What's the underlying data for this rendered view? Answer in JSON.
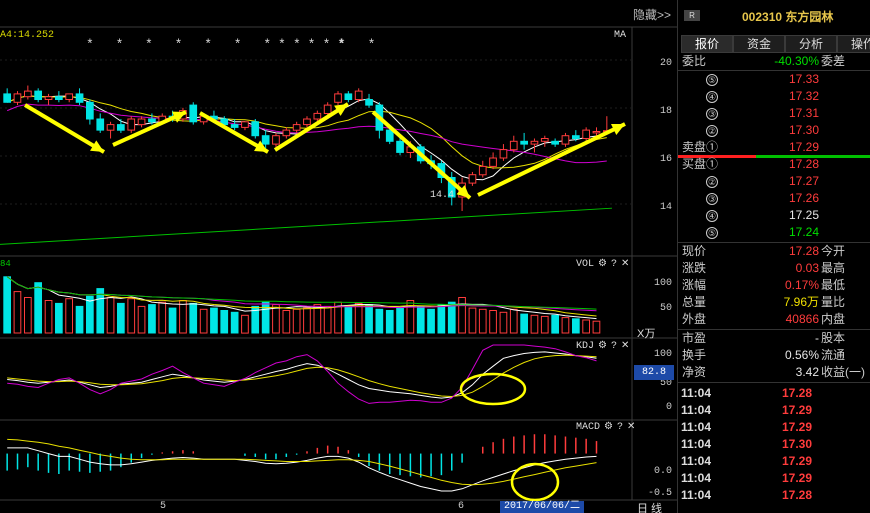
{
  "toolbar": {
    "hide_label": "隐藏>>"
  },
  "main_chart": {
    "ma_readout": "A4:14.252",
    "ma_tag": "MA",
    "stars": [
      "* *",
      "* * * * * * *",
      "* * *",
      "* *"
    ],
    "price_ticks": [
      "20",
      "18",
      "16",
      "14"
    ],
    "min_label": "14.4"
  },
  "vol_panel": {
    "label": "84",
    "title": "VOL",
    "ticks": [
      "100",
      "50"
    ],
    "unit": "X万"
  },
  "kdj_panel": {
    "title": "KDJ",
    "ticks": [
      "100",
      "50",
      "0"
    ],
    "badge": "82.8"
  },
  "macd_panel": {
    "title": "MACD",
    "ticks": [
      "0.0",
      "-0.5"
    ]
  },
  "panel_icons": {
    "gear": "gear-icon",
    "help": "?",
    "close": "✕"
  },
  "xaxis": {
    "ticks": [
      "5",
      "6"
    ],
    "date_badge": "2017/06/06/二",
    "period": "日线"
  },
  "colors": {
    "up": "#ff3c3c",
    "down": "#00e5e5",
    "ma1": "#ffffff",
    "ma2": "#e8e000",
    "ma3": "#d000d0",
    "ma4": "#00c000",
    "arrow": "#ffff00"
  },
  "chart_data": {
    "type": "candlestick",
    "price_axis": [
      13,
      21
    ],
    "notes": "Daily K-line with MA lines, VOL, KDJ and MACD sub-panels",
    "candles": [
      {
        "o": 18.6,
        "h": 18.8,
        "l": 18.3,
        "c": 18.3
      },
      {
        "o": 18.3,
        "h": 18.7,
        "l": 18.2,
        "c": 18.6
      },
      {
        "o": 18.5,
        "h": 18.9,
        "l": 18.4,
        "c": 18.7
      },
      {
        "o": 18.7,
        "h": 18.8,
        "l": 18.3,
        "c": 18.4
      },
      {
        "o": 18.4,
        "h": 18.6,
        "l": 18.2,
        "c": 18.5
      },
      {
        "o": 18.5,
        "h": 18.7,
        "l": 18.3,
        "c": 18.4
      },
      {
        "o": 18.4,
        "h": 18.6,
        "l": 18.3,
        "c": 18.6
      },
      {
        "o": 18.6,
        "h": 18.8,
        "l": 18.2,
        "c": 18.3
      },
      {
        "o": 18.3,
        "h": 18.4,
        "l": 17.5,
        "c": 17.7
      },
      {
        "o": 17.7,
        "h": 17.9,
        "l": 17.2,
        "c": 17.3
      },
      {
        "o": 17.3,
        "h": 17.6,
        "l": 17.0,
        "c": 17.5
      },
      {
        "o": 17.5,
        "h": 17.7,
        "l": 17.2,
        "c": 17.3
      },
      {
        "o": 17.3,
        "h": 17.8,
        "l": 17.2,
        "c": 17.7
      },
      {
        "o": 17.5,
        "h": 17.8,
        "l": 17.4,
        "c": 17.7
      },
      {
        "o": 17.7,
        "h": 17.9,
        "l": 17.5,
        "c": 17.6
      },
      {
        "o": 17.6,
        "h": 17.9,
        "l": 17.5,
        "c": 17.8
      },
      {
        "o": 17.8,
        "h": 18.0,
        "l": 17.6,
        "c": 17.7
      },
      {
        "o": 17.7,
        "h": 18.1,
        "l": 17.6,
        "c": 18.0
      },
      {
        "o": 18.2,
        "h": 18.3,
        "l": 17.5,
        "c": 17.6
      },
      {
        "o": 17.6,
        "h": 17.9,
        "l": 17.5,
        "c": 17.8
      },
      {
        "o": 17.8,
        "h": 18.0,
        "l": 17.6,
        "c": 17.7
      },
      {
        "o": 17.7,
        "h": 17.8,
        "l": 17.4,
        "c": 17.5
      },
      {
        "o": 17.5,
        "h": 17.7,
        "l": 17.3,
        "c": 17.4
      },
      {
        "o": 17.4,
        "h": 17.6,
        "l": 17.3,
        "c": 17.6
      },
      {
        "o": 17.6,
        "h": 17.7,
        "l": 17.0,
        "c": 17.1
      },
      {
        "o": 17.1,
        "h": 17.3,
        "l": 16.6,
        "c": 16.8
      },
      {
        "o": 16.8,
        "h": 17.2,
        "l": 16.7,
        "c": 17.1
      },
      {
        "o": 17.1,
        "h": 17.4,
        "l": 17.0,
        "c": 17.3
      },
      {
        "o": 17.3,
        "h": 17.6,
        "l": 17.2,
        "c": 17.5
      },
      {
        "o": 17.5,
        "h": 17.8,
        "l": 17.4,
        "c": 17.7
      },
      {
        "o": 17.7,
        "h": 18.0,
        "l": 17.6,
        "c": 17.9
      },
      {
        "o": 17.9,
        "h": 18.3,
        "l": 17.8,
        "c": 18.2
      },
      {
        "o": 18.3,
        "h": 18.7,
        "l": 18.2,
        "c": 18.6
      },
      {
        "o": 18.6,
        "h": 18.7,
        "l": 18.3,
        "c": 18.4
      },
      {
        "o": 18.4,
        "h": 18.8,
        "l": 18.3,
        "c": 18.7
      },
      {
        "o": 18.4,
        "h": 18.6,
        "l": 18.1,
        "c": 18.2
      },
      {
        "o": 18.2,
        "h": 18.3,
        "l": 17.0,
        "c": 17.3
      },
      {
        "o": 17.3,
        "h": 17.4,
        "l": 16.8,
        "c": 16.9
      },
      {
        "o": 16.9,
        "h": 17.1,
        "l": 16.4,
        "c": 16.5
      },
      {
        "o": 16.5,
        "h": 16.9,
        "l": 16.3,
        "c": 16.7
      },
      {
        "o": 16.7,
        "h": 16.8,
        "l": 16.1,
        "c": 16.2
      },
      {
        "o": 16.2,
        "h": 16.4,
        "l": 15.9,
        "c": 16.1
      },
      {
        "o": 16.1,
        "h": 16.2,
        "l": 15.4,
        "c": 15.6
      },
      {
        "o": 15.6,
        "h": 15.8,
        "l": 14.6,
        "c": 14.9
      },
      {
        "o": 14.9,
        "h": 15.6,
        "l": 14.4,
        "c": 15.4
      },
      {
        "o": 15.4,
        "h": 15.8,
        "l": 15.3,
        "c": 15.7
      },
      {
        "o": 15.7,
        "h": 16.2,
        "l": 15.6,
        "c": 16.0
      },
      {
        "o": 16.0,
        "h": 16.5,
        "l": 15.9,
        "c": 16.3
      },
      {
        "o": 16.3,
        "h": 16.8,
        "l": 16.2,
        "c": 16.6
      },
      {
        "o": 16.6,
        "h": 17.1,
        "l": 16.5,
        "c": 16.9
      },
      {
        "o": 16.9,
        "h": 17.2,
        "l": 16.6,
        "c": 16.8
      },
      {
        "o": 16.8,
        "h": 17.0,
        "l": 16.5,
        "c": 16.9
      },
      {
        "o": 16.9,
        "h": 17.1,
        "l": 16.7,
        "c": 17.0
      },
      {
        "o": 16.9,
        "h": 17.0,
        "l": 16.7,
        "c": 16.8
      },
      {
        "o": 16.8,
        "h": 17.2,
        "l": 16.7,
        "c": 17.1
      },
      {
        "o": 17.1,
        "h": 17.3,
        "l": 16.9,
        "c": 17.0
      },
      {
        "o": 17.0,
        "h": 17.4,
        "l": 16.9,
        "c": 17.3
      },
      {
        "o": 17.2,
        "h": 17.4,
        "l": 17.1,
        "c": 17.25
      },
      {
        "o": 17.25,
        "h": 17.8,
        "l": 17.2,
        "c": 17.28
      }
    ],
    "volume_axis": [
      0,
      120
    ],
    "volumes": [
      95,
      70,
      60,
      85,
      55,
      50,
      58,
      45,
      62,
      75,
      60,
      50,
      58,
      45,
      48,
      52,
      42,
      55,
      50,
      40,
      42,
      38,
      35,
      30,
      45,
      52,
      48,
      38,
      40,
      42,
      48,
      45,
      52,
      46,
      50,
      48,
      40,
      38,
      42,
      55,
      45,
      40,
      48,
      52,
      60,
      42,
      40,
      38,
      35,
      40,
      32,
      30,
      28,
      30,
      26,
      24,
      22,
      20
    ],
    "kdj_axis": [
      -20,
      110
    ],
    "kdj_k": [
      45,
      43,
      40,
      38,
      40,
      42,
      44,
      40,
      35,
      30,
      32,
      36,
      38,
      40,
      45,
      50,
      55,
      52,
      48,
      44,
      42,
      40,
      42,
      45,
      50,
      55,
      60,
      64,
      70,
      75,
      72,
      65,
      55,
      45,
      35,
      28,
      25,
      22,
      20,
      18,
      15,
      12,
      10,
      12,
      20,
      35,
      55,
      70,
      85,
      90,
      94,
      96,
      97,
      95,
      93,
      90,
      88,
      85
    ],
    "kdj_d": [
      48,
      46,
      44,
      42,
      41,
      41,
      42,
      41,
      39,
      36,
      35,
      35,
      36,
      37,
      40,
      43,
      47,
      49,
      48,
      47,
      46,
      44,
      43,
      44,
      46,
      49,
      52,
      56,
      61,
      66,
      68,
      67,
      63,
      57,
      50,
      43,
      37,
      32,
      28,
      24,
      20,
      17,
      14,
      13,
      15,
      21,
      32,
      44,
      57,
      68,
      77,
      84,
      88,
      90,
      91,
      90,
      89,
      88
    ],
    "kdj_j": [
      38,
      36,
      32,
      30,
      38,
      45,
      48,
      38,
      26,
      18,
      26,
      38,
      42,
      46,
      55,
      62,
      70,
      58,
      48,
      38,
      35,
      32,
      40,
      47,
      58,
      67,
      76,
      80,
      88,
      92,
      80,
      60,
      38,
      22,
      8,
      0,
      2,
      2,
      4,
      6,
      5,
      2,
      2,
      10,
      30,
      64,
      100,
      110,
      110,
      110,
      110,
      108,
      106,
      103,
      97,
      90,
      86,
      80
    ],
    "macd_axis": [
      -0.8,
      0.45
    ],
    "macd_dif": [
      0.1,
      0.1,
      0.1,
      0.05,
      0.0,
      -0.05,
      -0.05,
      -0.1,
      -0.15,
      -0.18,
      -0.2,
      -0.2,
      -0.18,
      -0.15,
      -0.12,
      -0.1,
      -0.08,
      -0.07,
      -0.08,
      -0.1,
      -0.1,
      -0.1,
      -0.1,
      -0.12,
      -0.14,
      -0.17,
      -0.18,
      -0.17,
      -0.15,
      -0.12,
      -0.08,
      -0.05,
      -0.05,
      -0.08,
      -0.15,
      -0.25,
      -0.33,
      -0.4,
      -0.46,
      -0.52,
      -0.58,
      -0.62,
      -0.66,
      -0.66,
      -0.62,
      -0.55,
      -0.48,
      -0.42,
      -0.36,
      -0.3,
      -0.25,
      -0.2,
      -0.16,
      -0.13,
      -0.1,
      -0.08,
      -0.06,
      -0.05
    ],
    "macd_dea": [
      0.25,
      0.24,
      0.22,
      0.2,
      0.17,
      0.13,
      0.1,
      0.06,
      0.02,
      -0.02,
      -0.05,
      -0.08,
      -0.1,
      -0.11,
      -0.11,
      -0.11,
      -0.1,
      -0.1,
      -0.1,
      -0.1,
      -0.1,
      -0.1,
      -0.1,
      -0.1,
      -0.11,
      -0.12,
      -0.13,
      -0.14,
      -0.14,
      -0.14,
      -0.13,
      -0.12,
      -0.11,
      -0.11,
      -0.12,
      -0.14,
      -0.18,
      -0.22,
      -0.27,
      -0.32,
      -0.37,
      -0.42,
      -0.47,
      -0.51,
      -0.54,
      -0.55,
      -0.54,
      -0.52,
      -0.49,
      -0.45,
      -0.41,
      -0.37,
      -0.33,
      -0.29,
      -0.25,
      -0.22,
      -0.19,
      -0.16
    ]
  },
  "quote": {
    "badge": "R",
    "code": "002310",
    "name": "东方园林",
    "tabs": [
      "报价",
      "资金",
      "分析",
      "操作"
    ],
    "weibi_label": "委比",
    "weibi_value": "-40.30%",
    "weicha_label": "委差",
    "sell": [
      {
        "idx": "⑤",
        "price": "17.33"
      },
      {
        "idx": "④",
        "price": "17.32"
      },
      {
        "idx": "③",
        "price": "17.31"
      },
      {
        "idx": "②",
        "price": "17.30"
      },
      {
        "label": "卖盘①",
        "price": "17.29"
      }
    ],
    "buy": [
      {
        "label": "买盘①",
        "price": "17.28"
      },
      {
        "idx": "②",
        "price": "17.27"
      },
      {
        "idx": "③",
        "price": "17.26"
      },
      {
        "idx": "④",
        "price": "17.25"
      },
      {
        "idx": "⑤",
        "price": "17.24"
      }
    ],
    "stats": [
      {
        "l": "现价",
        "v": "17.28",
        "r": "今开"
      },
      {
        "l": "涨跌",
        "v": "0.03",
        "r": "最高"
      },
      {
        "l": "涨幅",
        "v": "0.17%",
        "r": "最低"
      },
      {
        "l": "总量",
        "v": "7.96万",
        "r": "量比"
      },
      {
        "l": "外盘",
        "v": "40866",
        "r": "内盘"
      }
    ],
    "fin": [
      {
        "l": "市盈",
        "v": "-",
        "r": "股本"
      },
      {
        "l": "换手",
        "v": "0.56%",
        "r": "流通"
      },
      {
        "l": "净资",
        "v": "3.42",
        "r": "收益(一)"
      }
    ],
    "trades": [
      {
        "t": "11:04",
        "p": "17.28"
      },
      {
        "t": "11:04",
        "p": "17.29"
      },
      {
        "t": "11:04",
        "p": "17.29"
      },
      {
        "t": "11:04",
        "p": "17.30"
      },
      {
        "t": "11:04",
        "p": "17.29"
      },
      {
        "t": "11:04",
        "p": "17.29"
      },
      {
        "t": "11:04",
        "p": "17.28"
      }
    ]
  }
}
